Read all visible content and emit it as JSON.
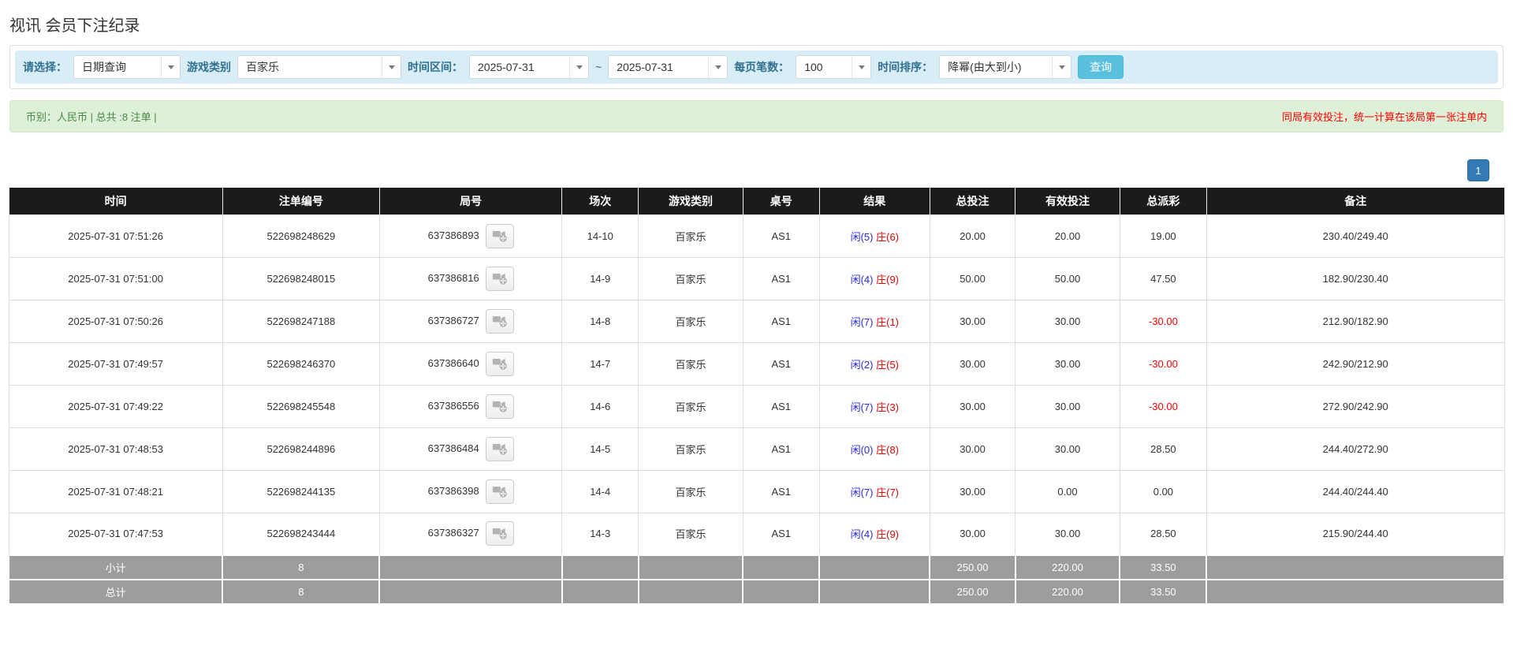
{
  "page": {
    "title": "视讯 会员下注纪录"
  },
  "filters": {
    "select_label": "请选择：",
    "select_value": "日期查询",
    "game_type_label": "游戏类别",
    "game_type_value": "百家乐",
    "date_range_label": "时间区间：",
    "date_from": "2025-07-31",
    "date_separator": "~",
    "date_to": "2025-07-31",
    "page_size_label": "每页笔数：",
    "page_size_value": "100",
    "sort_label": "时间排序：",
    "sort_value": "降幂(由大到小)",
    "search_button": "查询"
  },
  "summary": {
    "left_text": "币别：人民币 | 总共 :8 注单 |",
    "right_note": "同局有效投注，统一计算在该局第一张注单内"
  },
  "pagination": {
    "page": "1"
  },
  "icons": {
    "video_icon": "video-replay-icon",
    "combo_arrow": "chevron-down-icon"
  },
  "colors": {
    "accent_blue": "#5bc0de",
    "pagination_blue": "#337ab7",
    "link_blue": "#428bca",
    "result_player_blue": "#2b2bd5",
    "result_banker_red": "#e60000",
    "negative_red": "#ff0000",
    "header_bg": "#1b1b1b",
    "footer_bg": "#9d9d9d",
    "filter_bg": "#d9edf7",
    "filter_label": "#31708f",
    "summary_bg": "#dff0d8",
    "summary_text": "#468847",
    "note_red": "#ff0000"
  },
  "table": {
    "headers": [
      "时间",
      "注单编号",
      "局号",
      "场次",
      "游戏类别",
      "桌号",
      "结果",
      "总投注",
      "有效投注",
      "总派彩",
      "备注"
    ],
    "rows": [
      {
        "time": "2025-07-31 07:51:26",
        "bet_id": "522698248629",
        "round_id": "637386893",
        "session": "14-10",
        "game": "百家乐",
        "table_no": "AS1",
        "result_player": "闲(5)",
        "result_banker": "庄(6)",
        "total_bet": "20.00",
        "valid_bet": "20.00",
        "payout": "19.00",
        "remark": "230.40/249.40"
      },
      {
        "time": "2025-07-31 07:51:00",
        "bet_id": "522698248015",
        "round_id": "637386816",
        "session": "14-9",
        "game": "百家乐",
        "table_no": "AS1",
        "result_player": "闲(4)",
        "result_banker": "庄(9)",
        "total_bet": "50.00",
        "valid_bet": "50.00",
        "payout": "47.50",
        "remark": "182.90/230.40"
      },
      {
        "time": "2025-07-31 07:50:26",
        "bet_id": "522698247188",
        "round_id": "637386727",
        "session": "14-8",
        "game": "百家乐",
        "table_no": "AS1",
        "result_player": "闲(7)",
        "result_banker": "庄(1)",
        "total_bet": "30.00",
        "valid_bet": "30.00",
        "payout": "-30.00",
        "remark": "212.90/182.90"
      },
      {
        "time": "2025-07-31 07:49:57",
        "bet_id": "522698246370",
        "round_id": "637386640",
        "session": "14-7",
        "game": "百家乐",
        "table_no": "AS1",
        "result_player": "闲(2)",
        "result_banker": "庄(5)",
        "total_bet": "30.00",
        "valid_bet": "30.00",
        "payout": "-30.00",
        "remark": "242.90/212.90"
      },
      {
        "time": "2025-07-31 07:49:22",
        "bet_id": "522698245548",
        "round_id": "637386556",
        "session": "14-6",
        "game": "百家乐",
        "table_no": "AS1",
        "result_player": "闲(7)",
        "result_banker": "庄(3)",
        "total_bet": "30.00",
        "valid_bet": "30.00",
        "payout": "-30.00",
        "remark": "272.90/242.90"
      },
      {
        "time": "2025-07-31 07:48:53",
        "bet_id": "522698244896",
        "round_id": "637386484",
        "session": "14-5",
        "game": "百家乐",
        "table_no": "AS1",
        "result_player": "闲(0)",
        "result_banker": "庄(8)",
        "total_bet": "30.00",
        "valid_bet": "30.00",
        "payout": "28.50",
        "remark": "244.40/272.90"
      },
      {
        "time": "2025-07-31 07:48:21",
        "bet_id": "522698244135",
        "round_id": "637386398",
        "session": "14-4",
        "game": "百家乐",
        "table_no": "AS1",
        "result_player": "闲(7)",
        "result_banker": "庄(7)",
        "total_bet": "30.00",
        "valid_bet": "0.00",
        "payout": "0.00",
        "remark": "244.40/244.40"
      },
      {
        "time": "2025-07-31 07:47:53",
        "bet_id": "522698243444",
        "round_id": "637386327",
        "session": "14-3",
        "game": "百家乐",
        "table_no": "AS1",
        "result_player": "闲(4)",
        "result_banker": "庄(9)",
        "total_bet": "30.00",
        "valid_bet": "30.00",
        "payout": "28.50",
        "remark": "215.90/244.40"
      }
    ],
    "footer": [
      {
        "label": "小计",
        "count": "8",
        "total_bet": "250.00",
        "valid_bet": "220.00",
        "payout": "33.50"
      },
      {
        "label": "总计",
        "count": "8",
        "total_bet": "250.00",
        "valid_bet": "220.00",
        "payout": "33.50"
      }
    ]
  }
}
